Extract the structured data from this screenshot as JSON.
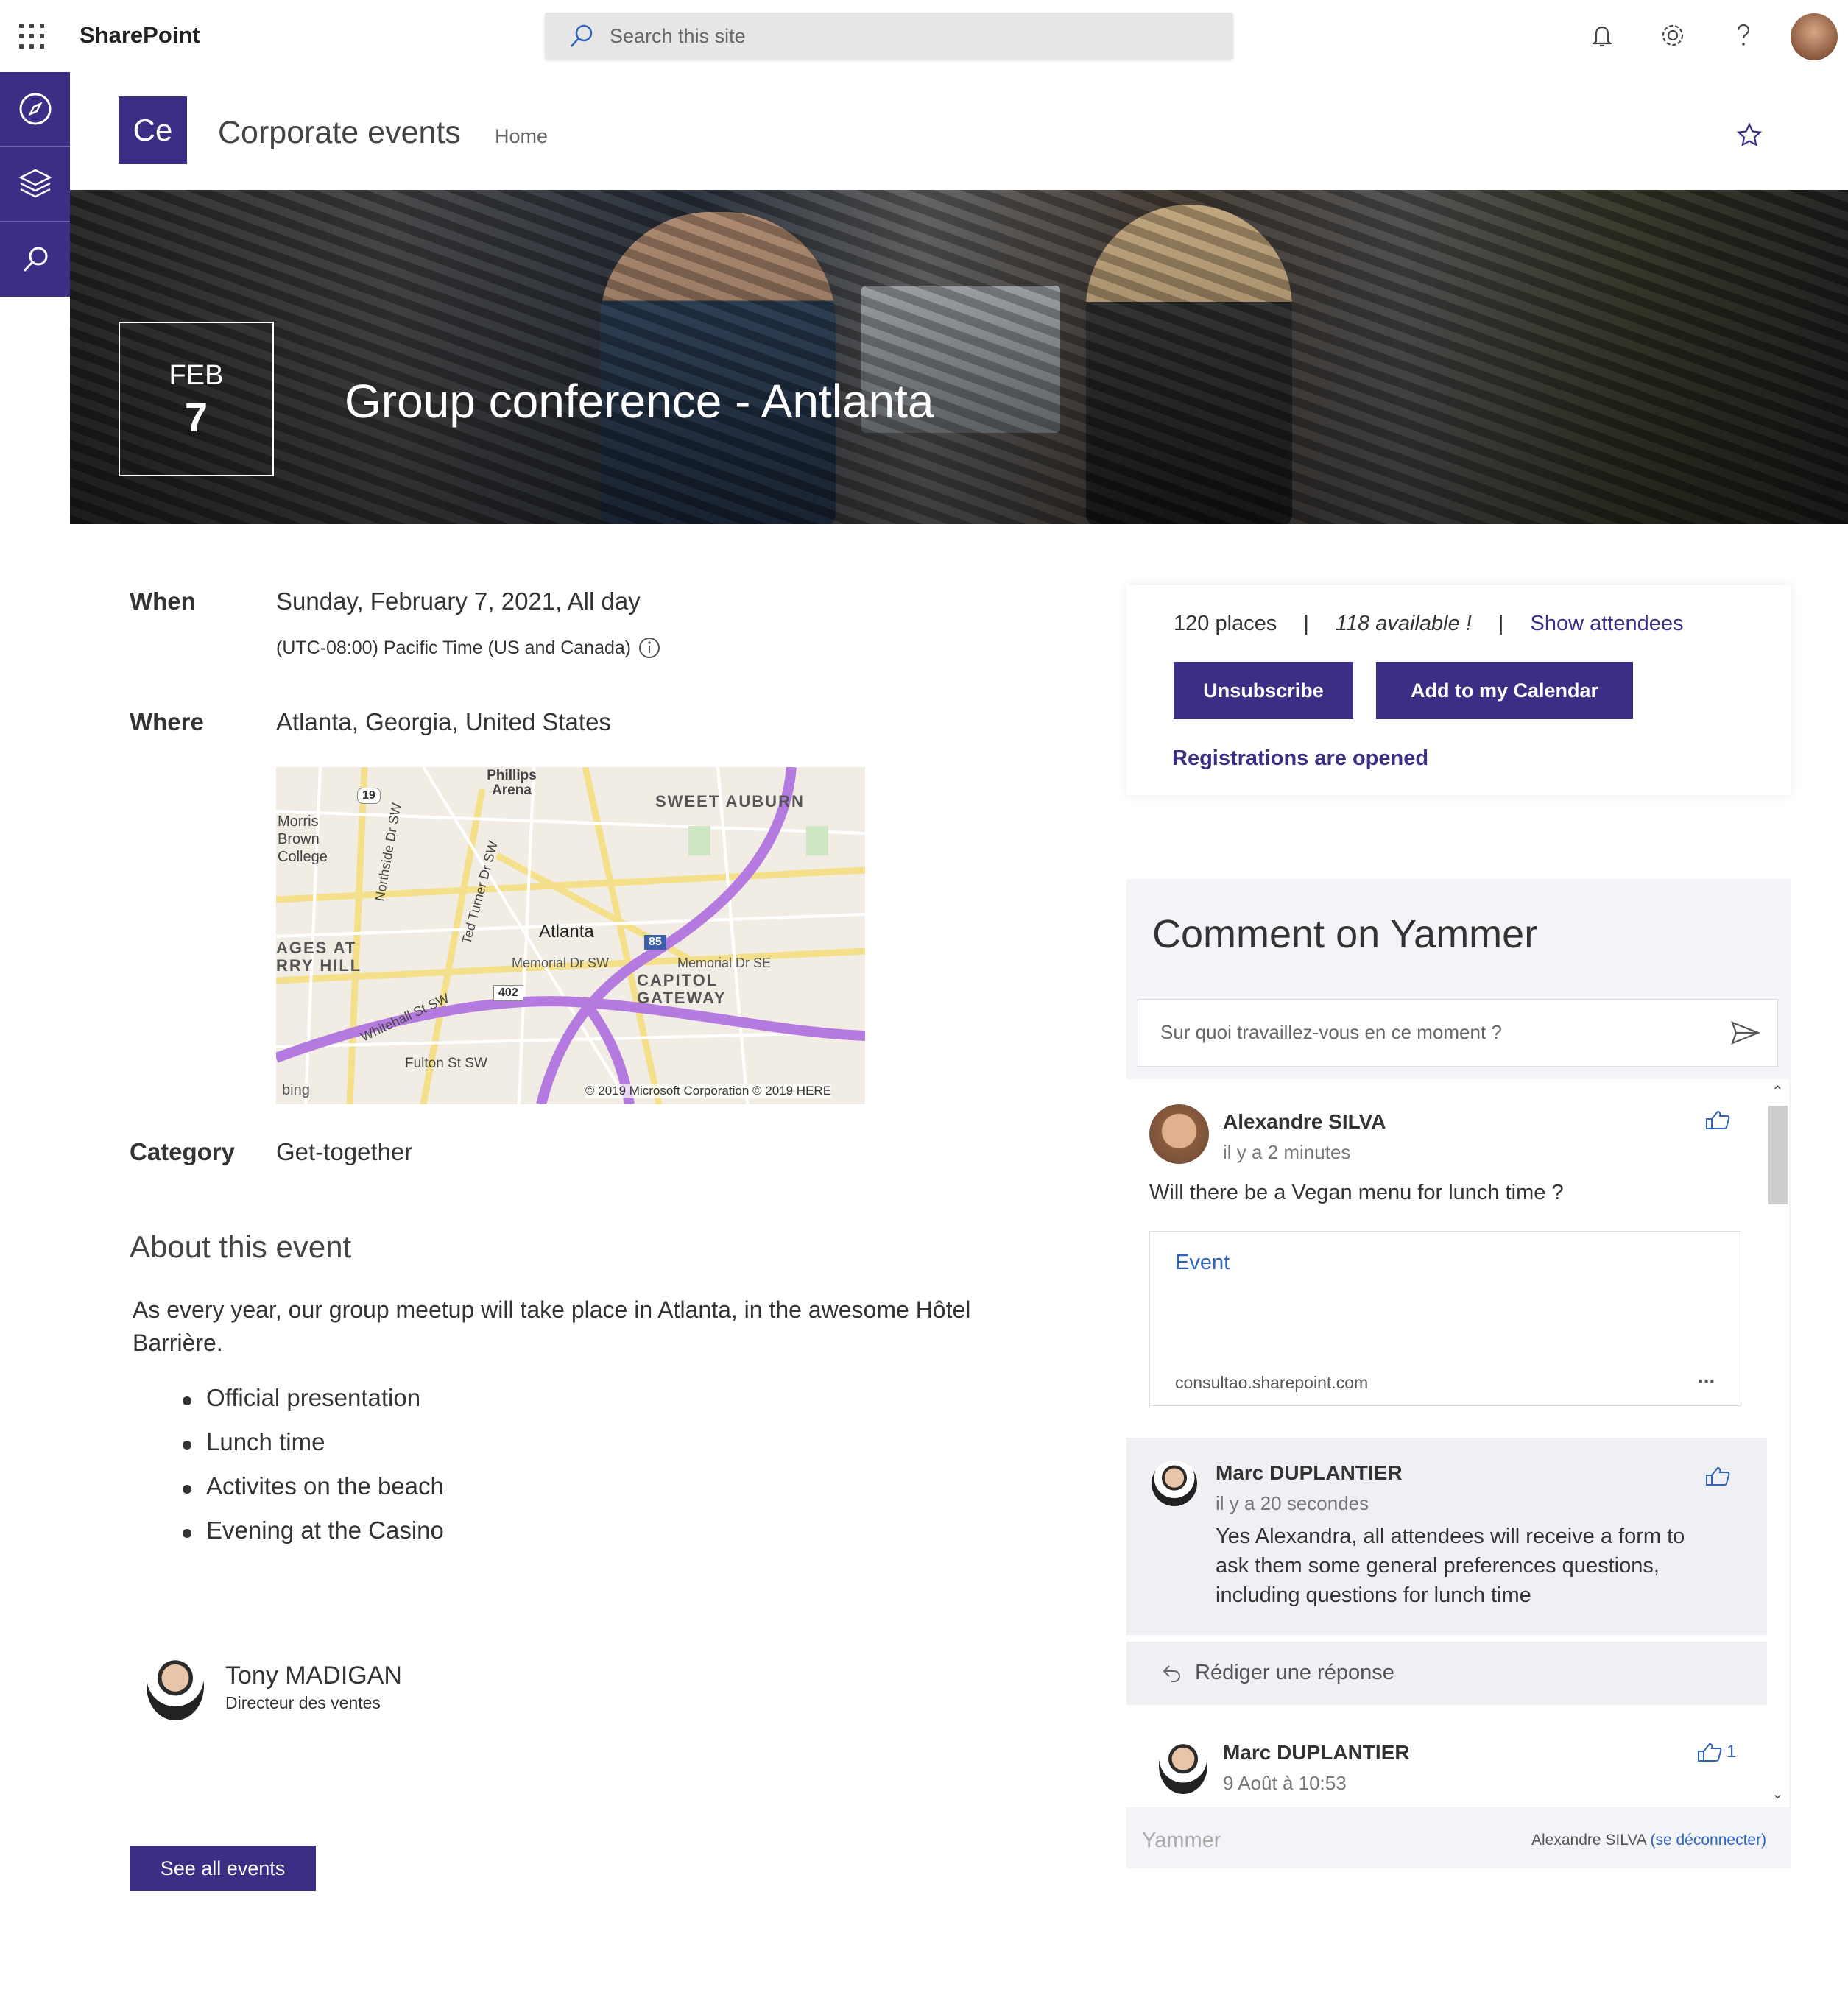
{
  "topbar": {
    "brand": "SharePoint",
    "search_placeholder": "Search this site",
    "icons": [
      "waffle-icon",
      "search-icon",
      "bell-icon",
      "gear-icon",
      "help-icon",
      "avatar"
    ]
  },
  "rail": {
    "items": [
      "compass-icon",
      "layers-icon",
      "search-icon"
    ]
  },
  "site": {
    "logo": "Ce",
    "title": "Corporate events",
    "nav": [
      "Home"
    ]
  },
  "hero": {
    "month": "FEB",
    "day": "7",
    "title": "Group conference - Antlanta"
  },
  "details": {
    "when_label": "When",
    "when_value": "Sunday, February 7, 2021, All day",
    "timezone": "(UTC-08:00) Pacific Time (US and Canada)",
    "where_label": "Where",
    "where_value": "Atlanta, Georgia, United States",
    "category_label": "Category",
    "category_value": "Get-together"
  },
  "map": {
    "labels": [
      "Phillips Arena",
      "SWEET AUBURN",
      "Morris Brown College",
      "Atlanta",
      "CAPITOL GATEWAY",
      "AGES AT RRY HILL",
      "Fulton St SW",
      "Memorial Dr SW",
      "Memorial Dr SE",
      "Ted Turner Dr SW",
      "Northside Dr SW",
      "Whitehall St SW",
      "19",
      "85",
      "402"
    ],
    "bing": "bing",
    "copyright": "© 2019 Microsoft Corporation © 2019 HERE"
  },
  "about": {
    "title": "About this event",
    "text": "As every year, our group meetup will take place in Atlanta, in the awesome Hôtel Barrière.",
    "bullets": [
      "Official presentation",
      "Lunch time",
      "Activites on the beach",
      "Evening at the Casino"
    ]
  },
  "contact": {
    "name": "Tony MADIGAN",
    "role": "Directeur des ventes"
  },
  "see_all": "See all events",
  "registration": {
    "places": "120 places",
    "sep": "|",
    "available": "118 available !",
    "show_attendees": "Show attendees",
    "unsubscribe": "Unsubscribe",
    "add_calendar": "Add to my Calendar",
    "status": "Registrations are opened"
  },
  "yammer": {
    "title": "Comment on Yammer",
    "input_placeholder": "Sur quoi travaillez-vous en ce moment ?",
    "posts": [
      {
        "author": "Alexandre SILVA",
        "time": "il y a 2 minutes",
        "body": "Will there be a Vegan menu for lunch time ?",
        "card_title": "Event",
        "card_domain": "consultao.sharepoint.com",
        "card_more": "..."
      },
      {
        "author": "Marc DUPLANTIER",
        "time": "il y a 20 secondes",
        "body": "Yes Alexandra, all attendees will receive a form to ask them some general preferences questions, including questions for lunch time"
      },
      {
        "author": "Marc DUPLANTIER",
        "time": "9 Août à 10:53",
        "likes": "1"
      }
    ],
    "reply": "Rédiger une réponse",
    "footer_brand": "Yammer",
    "footer_user": "Alexandre SILVA",
    "footer_logout": "(se déconnecter)"
  },
  "colors": {
    "accent": "#3d2e85",
    "link": "#2f64b8"
  }
}
